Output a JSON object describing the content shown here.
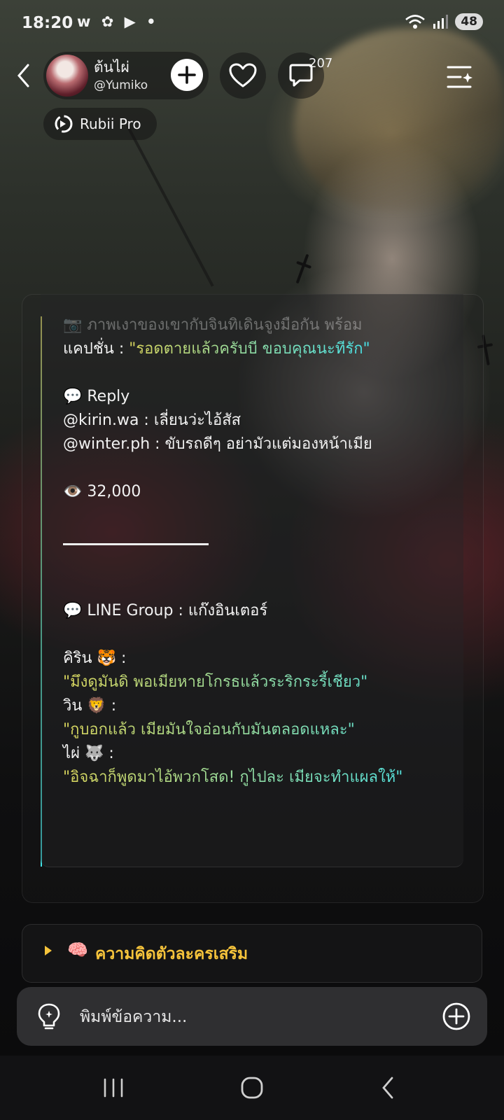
{
  "status_bar": {
    "time": "18:20",
    "app_icons": "w ✿ ▶ •",
    "battery": "48"
  },
  "header": {
    "profile_name": "ต้นไผ่",
    "profile_handle": "@Yumiko",
    "comment_count": "207",
    "plan_label": "Rubii Pro"
  },
  "chat": {
    "lines": [
      "📷 ภาพเงาของเขากับจินทิเดินจูงมือกัน พร้อม",
      "แคปชั่น : ",
      "\"รอดตายแล้วครับบี่ ขอบคุณนะที่รัก\"",
      "💬 Reply",
      "@kirin.wa : เลี่ยนว่ะไอ้สัส",
      "@winter.ph : ขับรถดีๆ อย่ามัวแต่มองหน้าเมีย",
      "👁️ 32,000",
      "💬 LINE Group : แก๊งอินเตอร์",
      "คิริน 🐯 :",
      "\"มึงดูมันดิ พอเมียหายโกรธแล้วระริกระรี้เชียว\"",
      "วิน 🦁 :",
      "\"กูบอกแล้ว เมียมันใจอ่อนกับมันตลอดแหละ\"",
      "ไผ่ 🐺 :",
      "\"อิจฉาก็พูดมาไอ้พวกโสด! กูไปละ เมียจะทำแผลให้\""
    ]
  },
  "thoughts": {
    "emoji": "🧠",
    "label": "ความคิดตัวละครเสริม"
  },
  "composer": {
    "placeholder": "พิมพ์ข้อความ..."
  },
  "colors": {
    "accent_yellow": "#f5c33b",
    "quote_start": "#d8d45c",
    "quote_end": "#47e3ea",
    "input_bg": "#2f2f31"
  }
}
